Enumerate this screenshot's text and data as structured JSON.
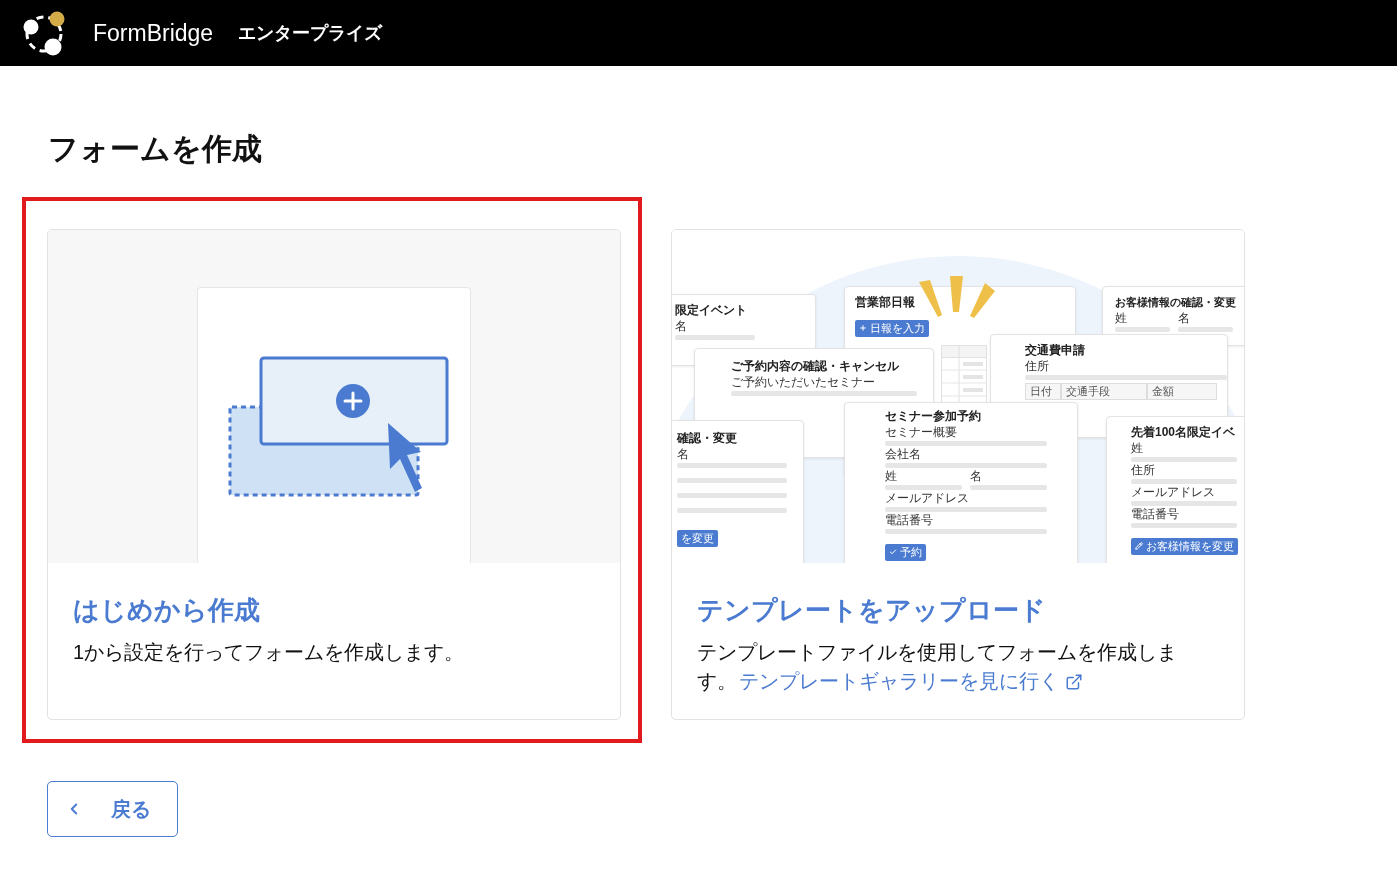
{
  "header": {
    "brand": "FormBridge",
    "edition": "エンタープライズ"
  },
  "page_title": "フォームを作成",
  "options": [
    {
      "kind": "scratch",
      "highlighted": true,
      "title": "はじめから作成",
      "description": "1から設定を行ってフォームを作成します。"
    },
    {
      "kind": "template",
      "highlighted": false,
      "title": "テンプレートをアップロード",
      "description": "テンプレートファイルを使用してフォームを作成します。",
      "link": "テンプレートギャラリーを見に行く",
      "illustration": {
        "forms": [
          {
            "title": "限定イベント",
            "field_groups": [
              [
                {
                  "label": "名"
                }
              ]
            ]
          },
          {
            "title": "営業部日報",
            "button": "日報を入力"
          },
          {
            "title": "ご予約内容の確認・キャンセル",
            "field_groups": [
              [
                {
                  "label": "ご予約いただいたセミナー"
                }
              ]
            ]
          },
          {
            "title": "お客様情報の確認・変更",
            "field_groups": [
              [
                {
                  "label": "姓"
                },
                {
                  "label": "名"
                }
              ]
            ]
          },
          {
            "title": "交通費申請",
            "field_groups": [
              [
                {
                  "label": "住所"
                }
              ]
            ],
            "table_headers": [
              "日付",
              "交通手段",
              "金額"
            ]
          },
          {
            "title": "確認・変更",
            "field_groups": [
              [
                {
                  "label": "名"
                }
              ]
            ],
            "button": "を変更"
          },
          {
            "title": "セミナー参加予約",
            "field_groups": [
              [
                {
                  "label": "セミナー概要"
                }
              ],
              [
                {
                  "label": "会社名"
                }
              ],
              [
                {
                  "label": "姓"
                },
                {
                  "label": "名"
                }
              ],
              [
                {
                  "label": "メールアドレス"
                }
              ],
              [
                {
                  "label": "電話番号"
                }
              ]
            ],
            "button": "予約"
          },
          {
            "title": "先着100名限定イベ",
            "field_groups": [
              [
                {
                  "label": "姓"
                }
              ],
              [
                {
                  "label": "住所"
                }
              ],
              [
                {
                  "label": "メールアドレス"
                }
              ],
              [
                {
                  "label": "電話番号"
                }
              ]
            ],
            "button": "お客様情報を変更"
          }
        ]
      }
    }
  ],
  "back_button": {
    "label": "戻る"
  }
}
